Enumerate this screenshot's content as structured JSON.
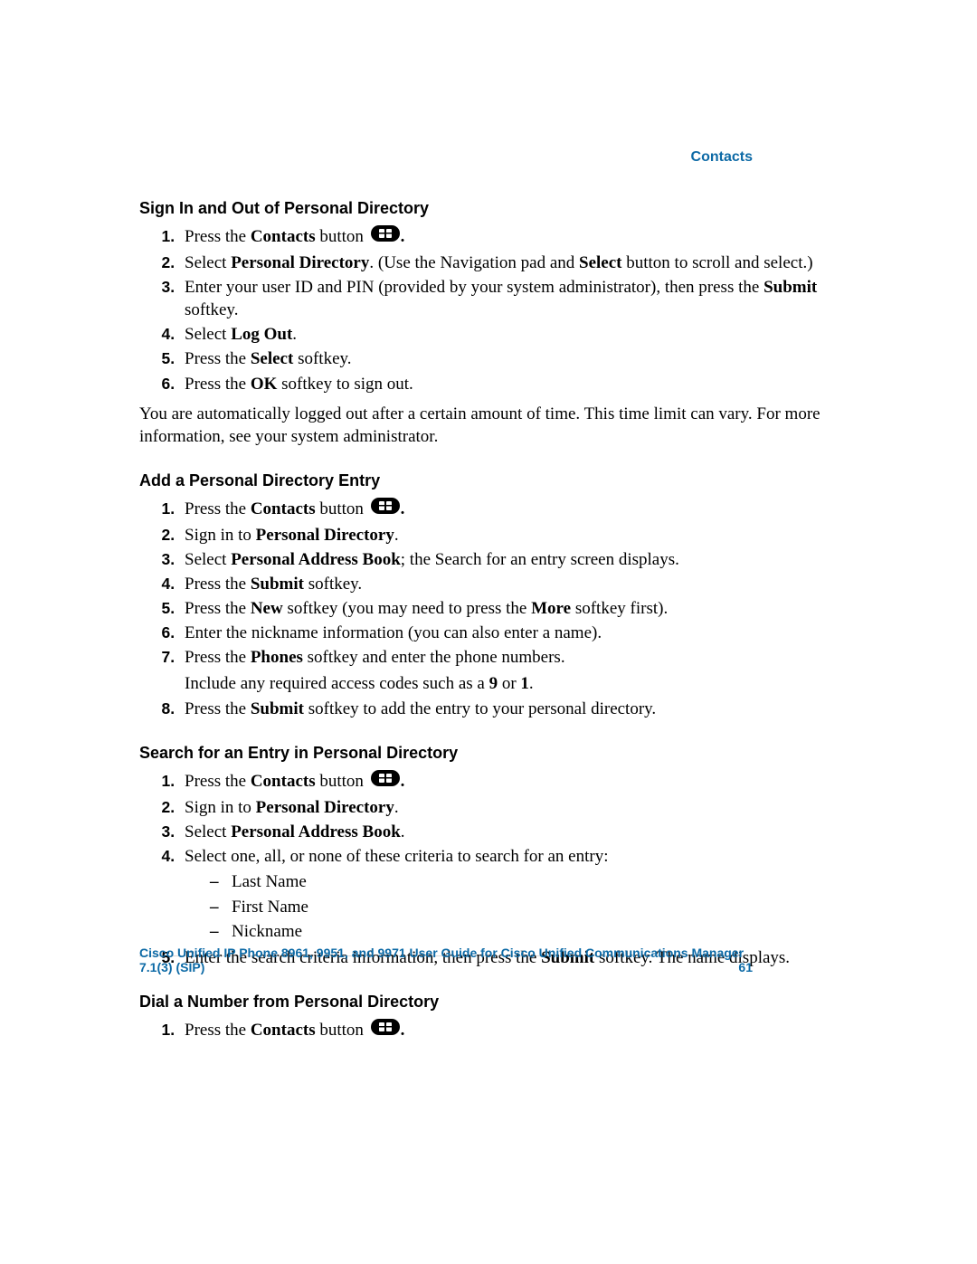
{
  "header": {
    "right": "Contacts"
  },
  "footer": {
    "title": "Cisco Unified IP Phone 8961, 9951, and 9971 User Guide for Cisco Unified Communications Manager 7.1(3) (SIP)",
    "page": "61"
  },
  "icons": {
    "contacts": "contacts-button-icon"
  },
  "sections": [
    {
      "heading": "Sign In and Out of Personal Directory",
      "steps": [
        {
          "pre": "Press the ",
          "b1": "Contacts",
          "mid": " button ",
          "icon": true,
          "b2": ".",
          "post": ""
        },
        {
          "pre": "Select ",
          "b1": "Personal Directory",
          "mid": ". (Use the Navigation pad and ",
          "b2": "Select",
          "post": " button to scroll and select.)"
        },
        {
          "pre": "Enter your user ID and PIN (provided by your system administrator), then press the ",
          "b1": "Submit",
          "mid": " softkey.",
          "post": ""
        },
        {
          "pre": "Select ",
          "b1": "Log Out",
          "mid": ".",
          "post": ""
        },
        {
          "pre": "Press the ",
          "b1": "Select",
          "mid": " softkey.",
          "post": ""
        },
        {
          "pre": "Press the ",
          "b1": "OK",
          "mid": " softkey to sign out.",
          "post": ""
        }
      ],
      "note": "You are automatically logged out after a certain amount of time. This time limit can vary. For more information, see your system administrator."
    },
    {
      "heading": "Add a Personal Directory Entry",
      "steps": [
        {
          "pre": "Press the ",
          "b1": "Contacts",
          "mid": " button ",
          "icon": true,
          "b2": ".",
          "post": ""
        },
        {
          "pre": "Sign in to ",
          "b1": "Personal Directory",
          "mid": ".",
          "post": ""
        },
        {
          "pre": "Select ",
          "b1": "Personal Address Book",
          "mid": "; the Search for an entry screen displays.",
          "post": ""
        },
        {
          "pre": "Press the ",
          "b1": "Submit",
          "mid": " softkey.",
          "post": ""
        },
        {
          "pre": "Press the ",
          "b1": "New",
          "mid": " softkey (you may need to press the ",
          "b2": "More",
          "post": " softkey first)."
        },
        {
          "pre": "Enter the nickname information (you can also enter a name).",
          "post": ""
        },
        {
          "pre": "Press the ",
          "b1": "Phones",
          "mid": " softkey and enter the phone numbers.",
          "post": "",
          "sub_pre": "Include any required access codes such as a ",
          "sub_b1": "9",
          "sub_mid": " or ",
          "sub_b2": "1",
          "sub_post": "."
        },
        {
          "pre": "Press the ",
          "b1": "Submit",
          "mid": " softkey to add the entry to your personal directory.",
          "post": ""
        }
      ]
    },
    {
      "heading": "Search for an Entry in Personal Directory",
      "steps": [
        {
          "pre": "Press the ",
          "b1": "Contacts",
          "mid": " button ",
          "icon": true,
          "b2": ".",
          "post": ""
        },
        {
          "pre": "Sign in to ",
          "b1": "Personal Directory",
          "mid": ".",
          "post": ""
        },
        {
          "pre": "Select ",
          "b1": "Personal Address Book",
          "mid": ".",
          "post": ""
        },
        {
          "pre": "Select one, all, or none of these criteria to search for an entry:",
          "post": "",
          "bullets": [
            "Last Name",
            "First Name",
            "Nickname"
          ]
        },
        {
          "pre": "Enter the search criteria information, then press the ",
          "b1": "Submit",
          "mid": " softkey. The name displays.",
          "post": ""
        }
      ]
    },
    {
      "heading": "Dial a Number from Personal Directory",
      "steps": [
        {
          "pre": "Press the ",
          "b1": "Contacts",
          "mid": " button ",
          "icon": true,
          "b2": ".",
          "post": ""
        }
      ]
    }
  ]
}
